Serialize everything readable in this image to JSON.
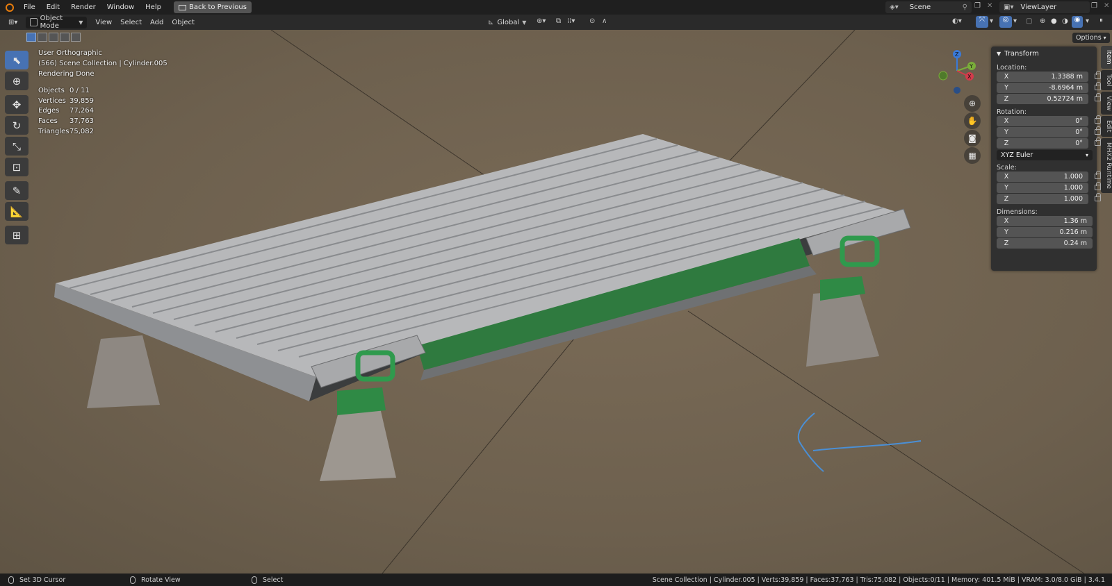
{
  "topbar": {
    "menus": [
      "File",
      "Edit",
      "Render",
      "Window",
      "Help"
    ],
    "back_label": "Back to Previous",
    "scene": "Scene",
    "view_layer": "ViewLayer"
  },
  "header": {
    "mode": "Object Mode",
    "menus": [
      "View",
      "Select",
      "Add",
      "Object"
    ],
    "orientation": "Global",
    "options_label": "Options"
  },
  "overlay": {
    "view_name": "User Orthographic",
    "collection": "(566) Scene Collection | Cylinder.005",
    "render_status": "Rendering Done",
    "stats": [
      {
        "label": "Objects",
        "value": "0 / 11"
      },
      {
        "label": "Vertices",
        "value": "39,859"
      },
      {
        "label": "Edges",
        "value": "77,264"
      },
      {
        "label": "Faces",
        "value": "37,763"
      },
      {
        "label": "Triangles",
        "value": "75,082"
      }
    ]
  },
  "toolbar": {
    "tools": [
      "select-box-icon",
      "cursor-icon",
      "move-icon",
      "rotate-icon",
      "scale-icon",
      "transform-icon",
      "annotate-icon",
      "measure-icon",
      "add-cube-icon"
    ]
  },
  "gizmo": {
    "x": "X",
    "y": "Y",
    "z": "Z"
  },
  "transform_panel": {
    "title": "Transform",
    "location_label": "Location:",
    "location": [
      {
        "axis": "X",
        "value": "1.3388 m"
      },
      {
        "axis": "Y",
        "value": "-8.6964 m"
      },
      {
        "axis": "Z",
        "value": "0.52724 m"
      }
    ],
    "rotation_label": "Rotation:",
    "rotation": [
      {
        "axis": "X",
        "value": "0°"
      },
      {
        "axis": "Y",
        "value": "0°"
      },
      {
        "axis": "Z",
        "value": "0°"
      }
    ],
    "rotation_mode": "XYZ Euler",
    "scale_label": "Scale:",
    "scale": [
      {
        "axis": "X",
        "value": "1.000"
      },
      {
        "axis": "Y",
        "value": "1.000"
      },
      {
        "axis": "Z",
        "value": "1.000"
      }
    ],
    "dimensions_label": "Dimensions:",
    "dimensions": [
      {
        "axis": "X",
        "value": "1.36 m"
      },
      {
        "axis": "Y",
        "value": "0.216 m"
      },
      {
        "axis": "Z",
        "value": "0.24 m"
      }
    ]
  },
  "side_tabs": [
    "Item",
    "Tool",
    "View",
    "Edit",
    "MHX2 Runtime"
  ],
  "statusbar": {
    "items": [
      "Set 3D Cursor",
      "Rotate View",
      "Select"
    ],
    "info": "Scene Collection | Cylinder.005 | Verts:39,859 | Faces:37,763 | Tris:75,082 | Objects:0/11 | Memory: 401.5 MiB | VRAM: 3.0/8.0 GiB | 3.4.1"
  },
  "colors": {
    "accent": "#4772b3",
    "belt_green": "#2f7a3f",
    "viewport_bg": "#6f6250"
  }
}
